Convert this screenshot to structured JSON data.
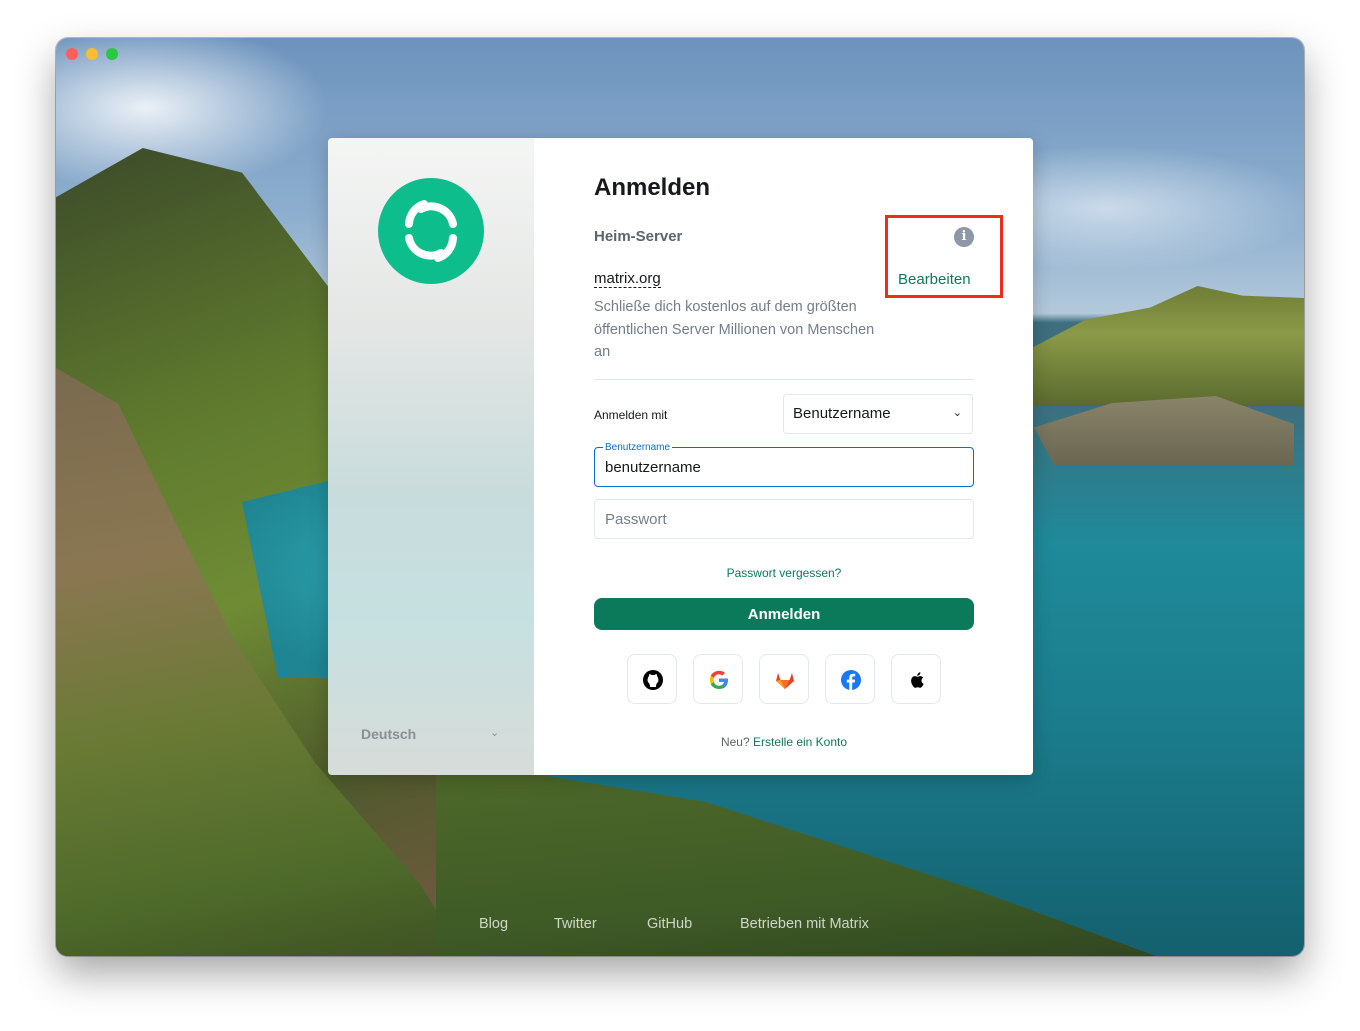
{
  "dialog": {
    "title": "Anmelden",
    "homeserver_label": "Heim-Server",
    "homeserver_value": "matrix.org",
    "edit_label": "Bearbeiten",
    "homeserver_description": "Schließe dich kostenlos auf dem größten öffentlichen Server Millionen von Menschen an",
    "login_with_label": "Anmelden mit",
    "login_with_selected": "Benutzername",
    "username_legend": "Benutzername",
    "username_value": "benutzername",
    "password_placeholder": "Passwort",
    "forgot_password": "Passwort vergessen?",
    "submit_label": "Anmelden",
    "signup_prefix": "Neu?",
    "signup_link": "Erstelle ein Konto"
  },
  "sso_providers": [
    {
      "name": "GitHub",
      "icon": "github-icon"
    },
    {
      "name": "Google",
      "icon": "google-icon"
    },
    {
      "name": "GitLab",
      "icon": "gitlab-icon"
    },
    {
      "name": "Facebook",
      "icon": "facebook-icon"
    },
    {
      "name": "Apple",
      "icon": "apple-icon"
    }
  ],
  "language": {
    "selected": "Deutsch"
  },
  "footer": {
    "links": [
      "Blog",
      "Twitter",
      "GitHub",
      "Betrieben mit Matrix"
    ]
  },
  "colors": {
    "accent": "#0a7a5a",
    "logo": "#0dbd8b",
    "highlight": "#ef2c1e",
    "focus": "#0d6bcf"
  }
}
